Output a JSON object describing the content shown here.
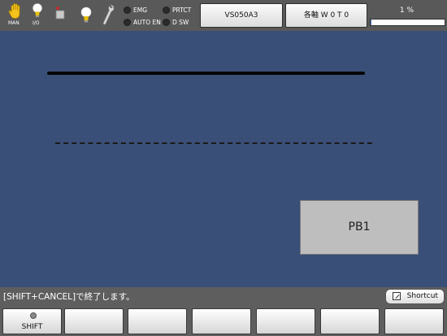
{
  "topbar": {
    "mode_label": "MAN",
    "io_label": "I/O",
    "indicators": [
      {
        "label": "EMG",
        "icon": "emg-indicator"
      },
      {
        "label": "PRTCT",
        "icon": "protect-indicator"
      },
      {
        "label": "AUTO EN",
        "icon": "auto-enable-indicator"
      },
      {
        "label": "D SW",
        "icon": "deadman-switch-indicator"
      }
    ],
    "robot_button": "VS050A3",
    "axis_button": "各軸  W 0 T 0",
    "progress_text": "1 %",
    "progress_value": 0.01
  },
  "main": {
    "pb1_label": "PB1"
  },
  "status": {
    "message": "[SHIFT+CANCEL]で終了します。",
    "shortcut_label": "Shortcut"
  },
  "fkeys": [
    "SHIFT",
    "",
    "",
    "",
    "",
    "",
    ""
  ],
  "colors": {
    "background": "#3a4f77",
    "bar": "#5e5e5e",
    "progress": "#4a7ad8"
  }
}
